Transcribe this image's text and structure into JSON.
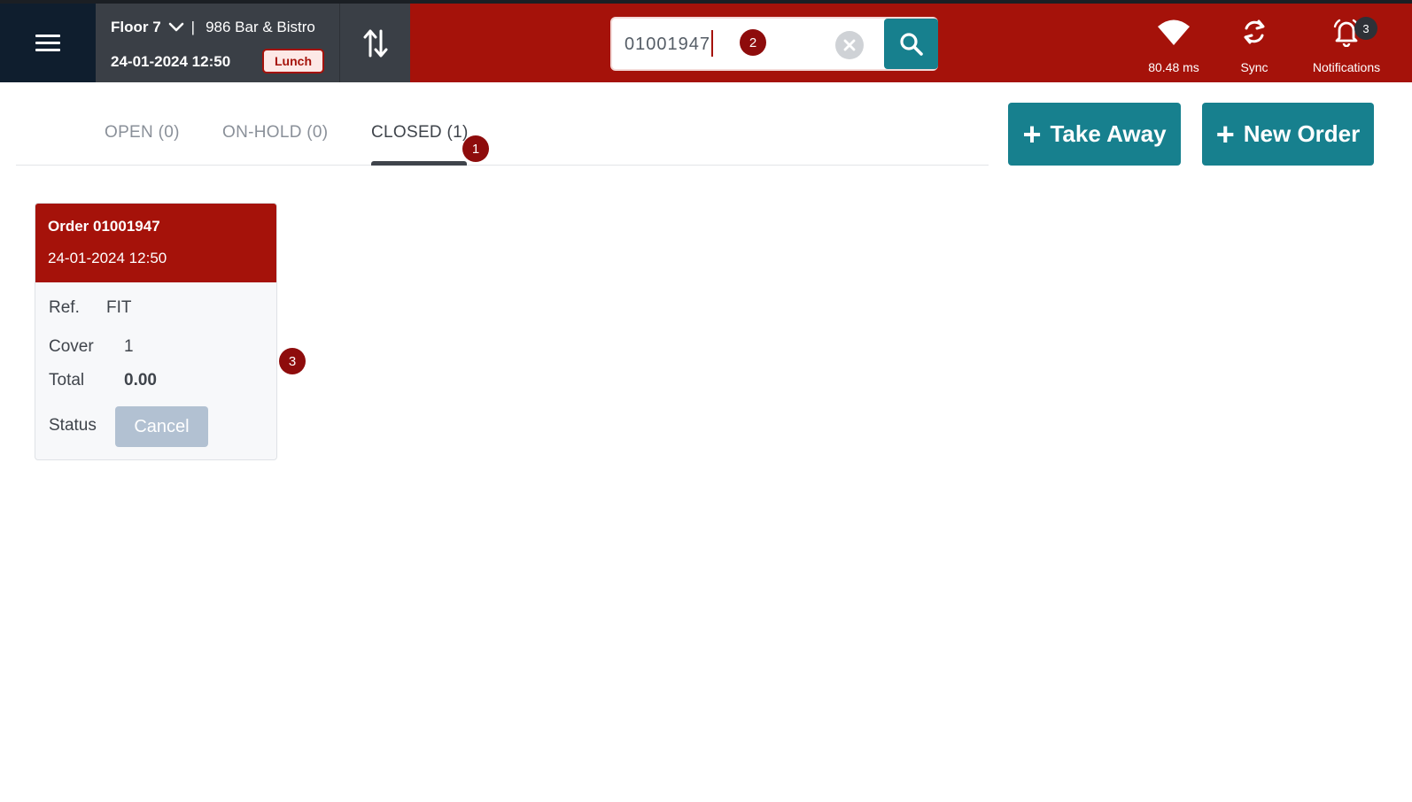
{
  "header": {
    "floor": "Floor 7",
    "separator": "|",
    "venue_name": "986 Bar & Bistro",
    "datetime": "24-01-2024 12:50",
    "meal_badge": "Lunch"
  },
  "search": {
    "value": "01001947",
    "placeholder": ""
  },
  "status": {
    "latency": "80.48 ms",
    "sync_label": "Sync",
    "notifications_label": "Notifications",
    "notifications_count": "3"
  },
  "tabs": [
    {
      "label": "OPEN (0)"
    },
    {
      "label": "ON-HOLD (0)"
    },
    {
      "label": "CLOSED (1)"
    }
  ],
  "actions": {
    "take_away": "Take Away",
    "new_order": "New Order"
  },
  "markers": [
    "1",
    "2",
    "3"
  ],
  "order_card": {
    "title": "Order 01001947",
    "datetime": "24-01-2024 12:50",
    "ref_label": "Ref.",
    "ref_value": "FIT",
    "cover_label": "Cover",
    "cover_value": "1",
    "total_label": "Total",
    "total_value": "0.00",
    "status_label": "Status",
    "status_value": "Cancel"
  },
  "colors": {
    "brand_red": "#a5120a",
    "teal": "#17808e",
    "dark_nav": "#0f1e2e",
    "venue_bg": "#3a3f46",
    "marker": "#8e0c0c"
  }
}
